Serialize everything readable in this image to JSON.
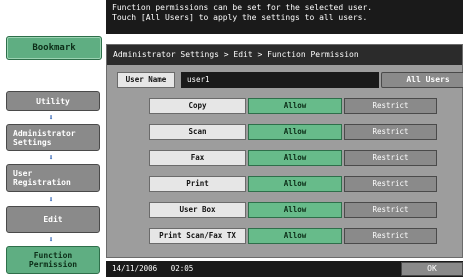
{
  "message": {
    "line1": "Function permissions can be set for the selected user.",
    "line2": "Touch [All Users] to apply the settings to all users."
  },
  "sidebar": {
    "bookmark_label": "Bookmark",
    "nav": [
      {
        "lines": [
          "Utility"
        ]
      },
      {
        "lines": [
          "Administrator",
          "Settings"
        ]
      },
      {
        "lines": [
          "User",
          "Registration"
        ]
      },
      {
        "lines": [
          "Edit"
        ]
      },
      {
        "lines": [
          "Function",
          "Permission"
        ]
      }
    ],
    "arrow_glyph": "⬇"
  },
  "breadcrumb": "Administrator Settings > Edit > Function Permission",
  "user": {
    "label": "User Name",
    "value": "user1",
    "all_users_label": "All Users"
  },
  "permissions": [
    {
      "label": "Copy",
      "allow": "Allow",
      "restrict": "Restrict",
      "selected": "allow"
    },
    {
      "label": "Scan",
      "allow": "Allow",
      "restrict": "Restrict",
      "selected": "allow"
    },
    {
      "label": "Fax",
      "allow": "Allow",
      "restrict": "Restrict",
      "selected": "allow"
    },
    {
      "label": "Print",
      "allow": "Allow",
      "restrict": "Restrict",
      "selected": "allow"
    },
    {
      "label": "User Box",
      "allow": "Allow",
      "restrict": "Restrict",
      "selected": "allow"
    },
    {
      "label": "Print Scan/Fax TX",
      "allow": "Allow",
      "restrict": "Restrict",
      "selected": "allow"
    }
  ],
  "status": {
    "date": "14/11/2006",
    "time": "02:05",
    "ok_label": "OK"
  },
  "colors": {
    "accent_green": "#67bb8a",
    "button_gray": "#8a8a8a",
    "panel_gray": "#9d9d9d",
    "header_black": "#1a1a1a"
  }
}
